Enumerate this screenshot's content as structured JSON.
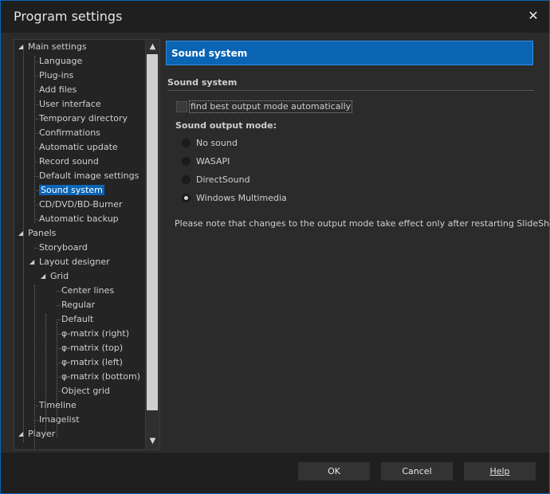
{
  "window": {
    "title": "Program settings",
    "close_glyph": "✕"
  },
  "tree": {
    "items": [
      {
        "label": "Main settings",
        "level": 0,
        "expander": "expanded"
      },
      {
        "label": "Language",
        "level": 1
      },
      {
        "label": "Plug-ins",
        "level": 1
      },
      {
        "label": "Add files",
        "level": 1
      },
      {
        "label": "User interface",
        "level": 1
      },
      {
        "label": "Temporary directory",
        "level": 1
      },
      {
        "label": "Confirmations",
        "level": 1
      },
      {
        "label": "Automatic update",
        "level": 1
      },
      {
        "label": "Record sound",
        "level": 1
      },
      {
        "label": "Default image settings",
        "level": 1
      },
      {
        "label": "Sound system",
        "level": 1,
        "selected": true
      },
      {
        "label": "CD/DVD/BD-Burner",
        "level": 1
      },
      {
        "label": "Automatic backup",
        "level": 1
      },
      {
        "label": "Panels",
        "level": 0,
        "expander": "expanded"
      },
      {
        "label": "Storyboard",
        "level": 1
      },
      {
        "label": "Layout designer",
        "level": 1,
        "expander": "expanded"
      },
      {
        "label": "Grid",
        "level": 2,
        "expander": "expanded"
      },
      {
        "label": "Center lines",
        "level": 3
      },
      {
        "label": "Regular",
        "level": 3
      },
      {
        "label": "Default",
        "level": 3
      },
      {
        "label": "φ-matrix (right)",
        "level": 3
      },
      {
        "label": "φ-matrix (top)",
        "level": 3
      },
      {
        "label": "φ-matrix (left)",
        "level": 3
      },
      {
        "label": "φ-matrix (bottom)",
        "level": 3
      },
      {
        "label": "Object grid",
        "level": 3
      },
      {
        "label": "Timeline",
        "level": 1
      },
      {
        "label": "Imagelist",
        "level": 1
      },
      {
        "label": "Player",
        "level": 0,
        "expander": "expanded"
      }
    ],
    "scroll_up_glyph": "▲",
    "scroll_down_glyph": "▼"
  },
  "content": {
    "header": "Sound system",
    "group_title": "Sound system",
    "auto_checkbox_label": "find best output mode automatically",
    "output_mode_title": "Sound output mode:",
    "radio_options": [
      {
        "label": "No sound",
        "checked": false
      },
      {
        "label": "WASAPI",
        "checked": false
      },
      {
        "label": "DirectSound",
        "checked": false
      },
      {
        "label": "Windows Multimedia",
        "checked": true
      }
    ],
    "note": "Please note that changes to the output mode take effect only after restarting SlideShow."
  },
  "footer": {
    "ok": "OK",
    "cancel": "Cancel",
    "help": "Help"
  },
  "colors": {
    "accent": "#0a64b4",
    "background": "#2b2b2b",
    "titlebar": "#1f1f1f"
  },
  "icons": {
    "close": "close-icon",
    "scroll_up": "scroll-up-icon",
    "scroll_down": "scroll-down-icon",
    "tree_expander": "tree-expander-icon"
  }
}
